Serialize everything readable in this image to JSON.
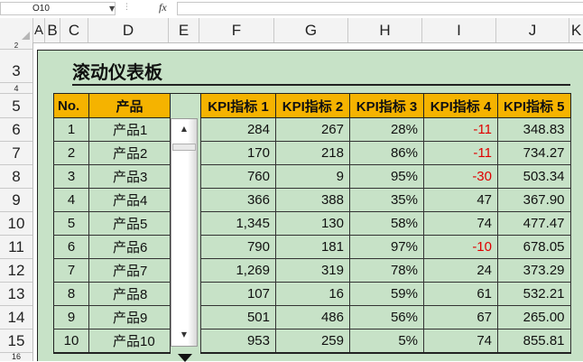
{
  "formula_bar": {
    "name_box": "O10",
    "fx_label": "fx",
    "formula": ""
  },
  "columns": [
    "A",
    "B",
    "C",
    "D",
    "E",
    "F",
    "G",
    "H",
    "I",
    "J",
    "K"
  ],
  "rows": [
    "2",
    "3",
    "4",
    "5",
    "6",
    "7",
    "8",
    "9",
    "10",
    "11",
    "12",
    "13",
    "14",
    "15",
    "16"
  ],
  "dashboard": {
    "title": "滚动仪表板",
    "headers": [
      "No.",
      "产品",
      "",
      "KPI指标 1",
      "KPI指标 2",
      "KPI指标 3",
      "KPI指标 4",
      "KPI指标 5"
    ],
    "rows": [
      {
        "no": "1",
        "product": "产品1",
        "k1": "284",
        "k2": "267",
        "k3": "28%",
        "k4": "-11",
        "k5": "348.83"
      },
      {
        "no": "2",
        "product": "产品2",
        "k1": "170",
        "k2": "218",
        "k3": "86%",
        "k4": "-11",
        "k5": "734.27"
      },
      {
        "no": "3",
        "product": "产品3",
        "k1": "760",
        "k2": "9",
        "k3": "95%",
        "k4": "-30",
        "k5": "503.34"
      },
      {
        "no": "4",
        "product": "产品4",
        "k1": "366",
        "k2": "388",
        "k3": "35%",
        "k4": "47",
        "k5": "367.90"
      },
      {
        "no": "5",
        "product": "产品5",
        "k1": "1,345",
        "k2": "130",
        "k3": "58%",
        "k4": "74",
        "k5": "477.47"
      },
      {
        "no": "6",
        "product": "产品6",
        "k1": "790",
        "k2": "181",
        "k3": "97%",
        "k4": "-10",
        "k5": "678.05"
      },
      {
        "no": "7",
        "product": "产品7",
        "k1": "1,269",
        "k2": "319",
        "k3": "78%",
        "k4": "24",
        "k5": "373.29"
      },
      {
        "no": "8",
        "product": "产品8",
        "k1": "107",
        "k2": "16",
        "k3": "59%",
        "k4": "61",
        "k5": "532.21"
      },
      {
        "no": "9",
        "product": "产品9",
        "k1": "501",
        "k2": "486",
        "k3": "56%",
        "k4": "67",
        "k5": "265.00"
      },
      {
        "no": "10",
        "product": "产品10",
        "k1": "953",
        "k2": "259",
        "k3": "5%",
        "k4": "74",
        "k5": "855.81"
      }
    ]
  },
  "colors": {
    "header_fill": "#f5b300",
    "dashboard_fill": "#c7e2c7",
    "negative": "#e00000"
  },
  "icons": {
    "scroll_up": "up-arrow-icon",
    "scroll_down": "down-arrow-icon",
    "name_box_dropdown": "chevron-down-icon",
    "cursor": "down-triangle-icon"
  }
}
